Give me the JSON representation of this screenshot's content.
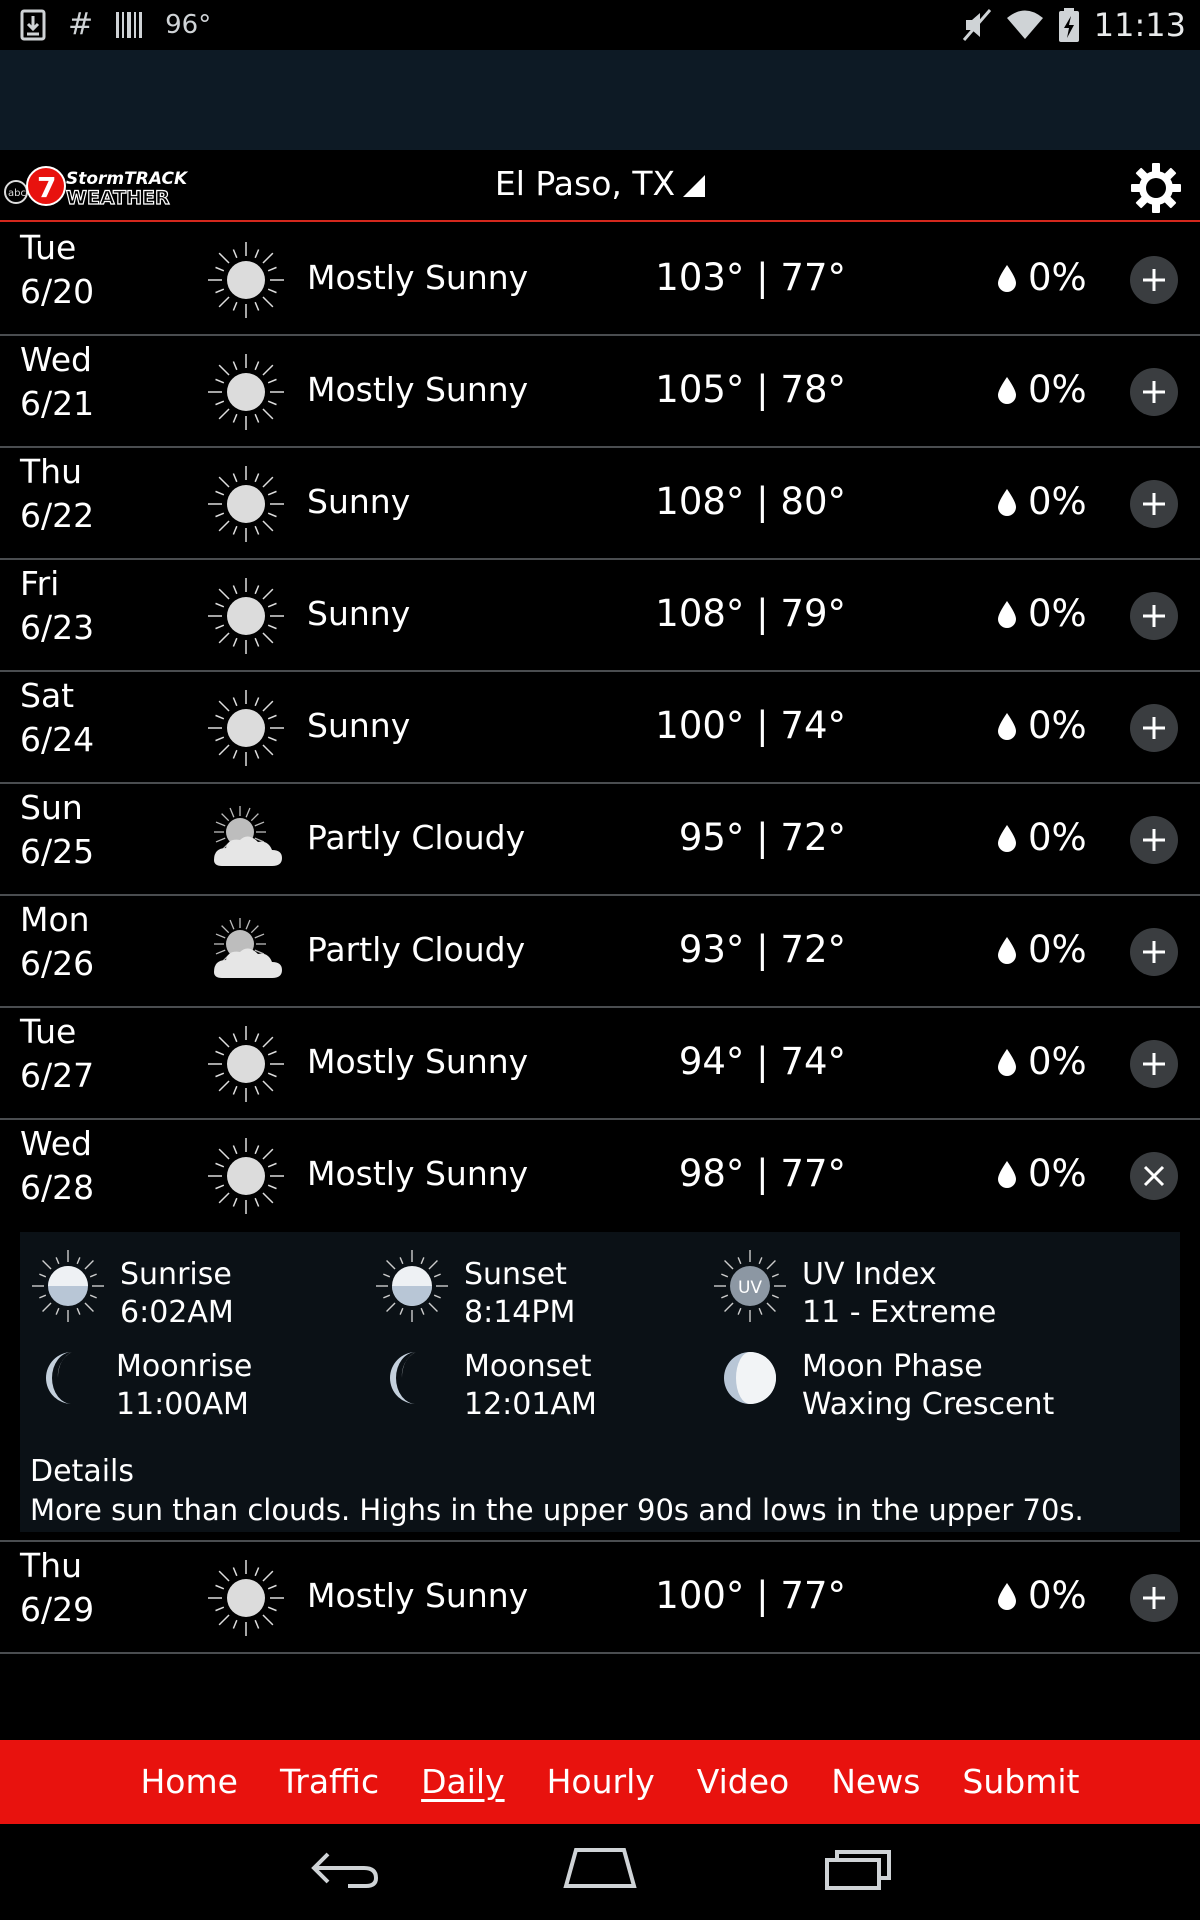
{
  "status_bar": {
    "temperature": "96°",
    "time": "11:13",
    "icons": [
      "download-icon",
      "hashtag-icon",
      "barcode-icon",
      "mute-icon",
      "wifi-icon",
      "battery-charging-icon"
    ]
  },
  "header": {
    "logo_text": "abc 7 StormTRACK WEATHER",
    "location": "El Paso, TX"
  },
  "forecast": [
    {
      "day": "Tue",
      "date": "6/20",
      "icon": "sun-icon",
      "condition": "Mostly Sunny",
      "temps": "103° | 77°",
      "precip": "0%",
      "expanded": false
    },
    {
      "day": "Wed",
      "date": "6/21",
      "icon": "sun-icon",
      "condition": "Mostly Sunny",
      "temps": "105° | 78°",
      "precip": "0%",
      "expanded": false
    },
    {
      "day": "Thu",
      "date": "6/22",
      "icon": "sun-icon",
      "condition": "Sunny",
      "temps": "108° | 80°",
      "precip": "0%",
      "expanded": false
    },
    {
      "day": "Fri",
      "date": "6/23",
      "icon": "sun-icon",
      "condition": "Sunny",
      "temps": "108° | 79°",
      "precip": "0%",
      "expanded": false
    },
    {
      "day": "Sat",
      "date": "6/24",
      "icon": "sun-icon",
      "condition": "Sunny",
      "temps": "100° | 74°",
      "precip": "0%",
      "expanded": false
    },
    {
      "day": "Sun",
      "date": "6/25",
      "icon": "partly-cloudy-icon",
      "condition": "Partly Cloudy",
      "temps": "95° | 72°",
      "precip": "0%",
      "expanded": false
    },
    {
      "day": "Mon",
      "date": "6/26",
      "icon": "partly-cloudy-icon",
      "condition": "Partly Cloudy",
      "temps": "93° | 72°",
      "precip": "0%",
      "expanded": false
    },
    {
      "day": "Tue",
      "date": "6/27",
      "icon": "sun-icon",
      "condition": "Mostly Sunny",
      "temps": "94° | 74°",
      "precip": "0%",
      "expanded": false
    },
    {
      "day": "Wed",
      "date": "6/28",
      "icon": "sun-icon",
      "condition": "Mostly Sunny",
      "temps": "98° | 77°",
      "precip": "0%",
      "expanded": true
    },
    {
      "day": "Thu",
      "date": "6/29",
      "icon": "sun-icon",
      "condition": "Mostly Sunny",
      "temps": "100° | 77°",
      "precip": "0%",
      "expanded": false
    }
  ],
  "detail": {
    "sunrise_label": "Sunrise",
    "sunrise_value": "6:02AM",
    "sunset_label": "Sunset",
    "sunset_value": "8:14PM",
    "uv_label": "UV Index",
    "uv_value": "11 - Extreme",
    "uv_icon_text": "UV",
    "moonrise_label": "Moonrise",
    "moonrise_value": "11:00AM",
    "moonset_label": "Moonset",
    "moonset_value": "12:01AM",
    "moonphase_label": "Moon Phase",
    "moonphase_value": "Waxing Crescent",
    "details_title": "Details",
    "details_text": "More sun than clouds. Highs in the upper 90s and lows in the upper 70s."
  },
  "bottom_nav": {
    "items": [
      "Home",
      "Traffic",
      "Daily",
      "Hourly",
      "Video",
      "News",
      "Submit"
    ],
    "active": "Daily"
  },
  "colors": {
    "accent_red": "#e8120e",
    "banner": "#0d1a25",
    "detail_bg": "#0b1116",
    "divider": "#4a4d50"
  }
}
